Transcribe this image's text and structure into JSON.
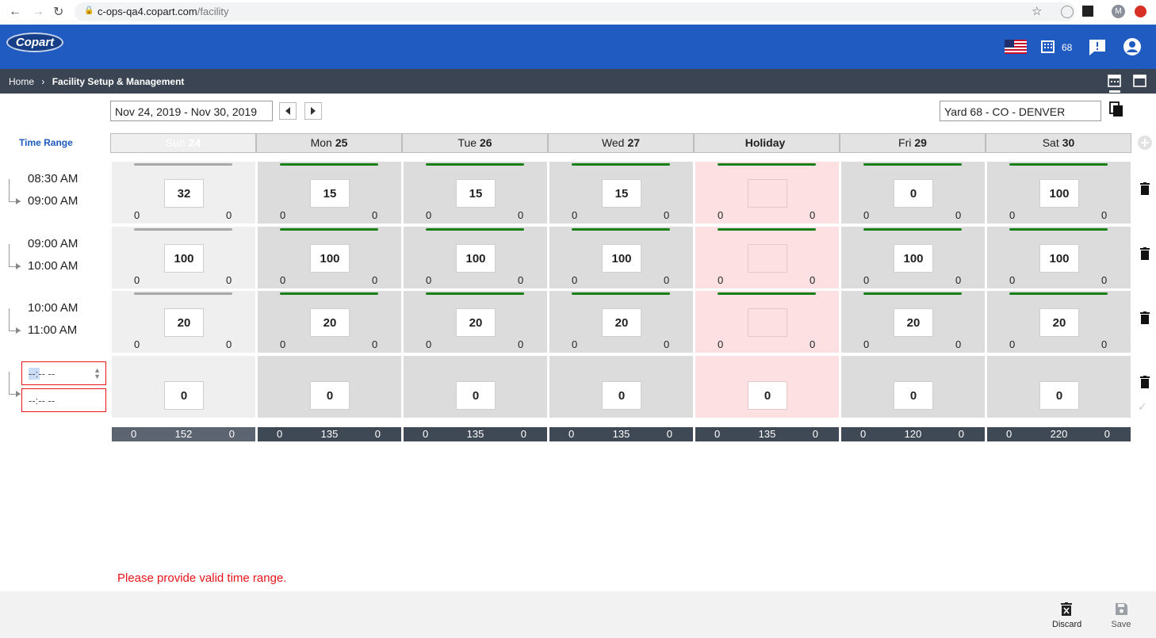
{
  "browser": {
    "url_host": "c-ops-qa4.copart.com",
    "url_path": "/facility"
  },
  "header": {
    "logo": "Copart",
    "yard_count": "68"
  },
  "breadcrumb": {
    "home": "Home",
    "current": "Facility Setup & Management"
  },
  "toolbar": {
    "date_range": "Nov 24, 2019 - Nov 30, 2019",
    "yard": "Yard 68 - CO - DENVER"
  },
  "grid": {
    "time_range_label": "Time Range",
    "days": [
      {
        "name": "Sun",
        "num": "24"
      },
      {
        "name": "Mon",
        "num": "25"
      },
      {
        "name": "Tue",
        "num": "26"
      },
      {
        "name": "Wed",
        "num": "27"
      },
      {
        "name": "Holiday",
        "num": ""
      },
      {
        "name": "Fri",
        "num": "29"
      },
      {
        "name": "Sat",
        "num": "30"
      }
    ],
    "rows": [
      {
        "start": "08:30 AM",
        "end": "09:00 AM",
        "cells": [
          {
            "v": "32",
            "l": "0",
            "r": "0"
          },
          {
            "v": "15",
            "l": "0",
            "r": "0"
          },
          {
            "v": "15",
            "l": "0",
            "r": "0"
          },
          {
            "v": "15",
            "l": "0",
            "r": "0"
          },
          {
            "v": "",
            "l": "0",
            "r": "0"
          },
          {
            "v": "0",
            "l": "0",
            "r": "0"
          },
          {
            "v": "100",
            "l": "0",
            "r": "0"
          }
        ]
      },
      {
        "start": "09:00 AM",
        "end": "10:00 AM",
        "cells": [
          {
            "v": "100",
            "l": "0",
            "r": "0"
          },
          {
            "v": "100",
            "l": "0",
            "r": "0"
          },
          {
            "v": "100",
            "l": "0",
            "r": "0"
          },
          {
            "v": "100",
            "l": "0",
            "r": "0"
          },
          {
            "v": "",
            "l": "0",
            "r": "0"
          },
          {
            "v": "100",
            "l": "0",
            "r": "0"
          },
          {
            "v": "100",
            "l": "0",
            "r": "0"
          }
        ]
      },
      {
        "start": "10:00 AM",
        "end": "11:00 AM",
        "cells": [
          {
            "v": "20",
            "l": "0",
            "r": "0"
          },
          {
            "v": "20",
            "l": "0",
            "r": "0"
          },
          {
            "v": "20",
            "l": "0",
            "r": "0"
          },
          {
            "v": "20",
            "l": "0",
            "r": "0"
          },
          {
            "v": "",
            "l": "0",
            "r": "0"
          },
          {
            "v": "20",
            "l": "0",
            "r": "0"
          },
          {
            "v": "20",
            "l": "0",
            "r": "0"
          }
        ]
      }
    ],
    "new_row": {
      "start": "--:-- --",
      "end": "--:-- --",
      "values": [
        "0",
        "0",
        "0",
        "0",
        "0",
        "0",
        "0"
      ]
    },
    "totals": [
      {
        "l": "0",
        "m": "152",
        "r": "0"
      },
      {
        "l": "0",
        "m": "135",
        "r": "0"
      },
      {
        "l": "0",
        "m": "135",
        "r": "0"
      },
      {
        "l": "0",
        "m": "135",
        "r": "0"
      },
      {
        "l": "0",
        "m": "135",
        "r": "0"
      },
      {
        "l": "0",
        "m": "120",
        "r": "0"
      },
      {
        "l": "0",
        "m": "220",
        "r": "0"
      }
    ]
  },
  "error": "Please provide valid time range.",
  "footer": {
    "discard": "Discard",
    "save": "Save"
  },
  "colors": {
    "header": "#1f5bc0",
    "subbar": "#3a4452",
    "active_bar": "#168016",
    "inactive_bar": "#a8a8a8",
    "holiday": "#fde1e2",
    "error": "#e8141a"
  }
}
